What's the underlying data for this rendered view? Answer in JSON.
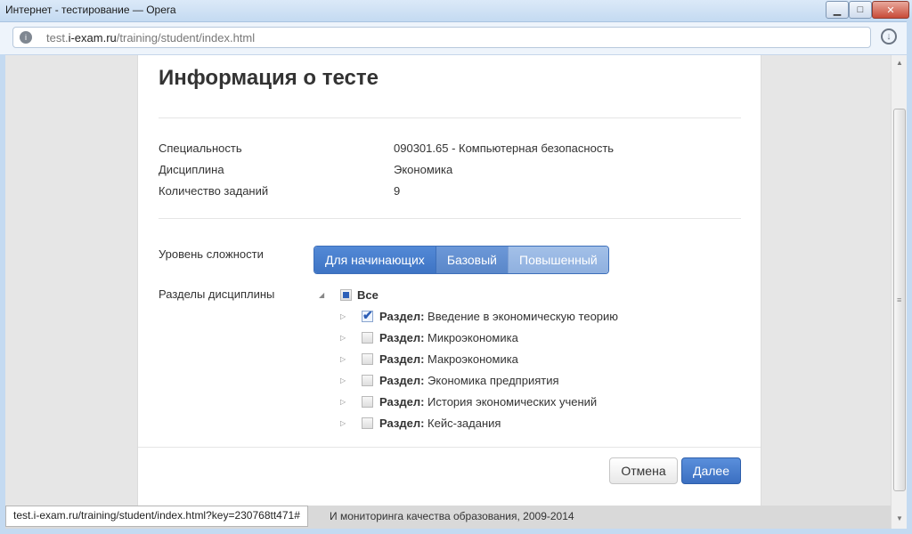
{
  "window": {
    "title": "Интернет - тестирование — Opera",
    "min_glyph": "▁",
    "max_glyph": "□",
    "close_glyph": "✕"
  },
  "address": {
    "prefix": "test.",
    "host": "i-exam.ru",
    "path": "/training/student/index.html",
    "site_icon": "info-icon",
    "download_icon": "download-icon"
  },
  "modal": {
    "title": "Информация о тесте",
    "info": [
      {
        "label": "Специальность",
        "value": "090301.65 - Компьютерная безопасность"
      },
      {
        "label": "Дисциплина",
        "value": "Экономика"
      },
      {
        "label": "Количество заданий",
        "value": "9"
      }
    ],
    "difficulty_label": "Уровень сложности",
    "difficulty_options": [
      "Для начинающих",
      "Базовый",
      "Повышенный"
    ],
    "difficulty_selected": "Для начинающих",
    "sections_label": "Разделы дисциплины",
    "tree_root": {
      "label": "Все",
      "state": "partial"
    },
    "section_prefix": "Раздел:",
    "sections": [
      {
        "name": "Введение в экономическую теорию",
        "checked": true
      },
      {
        "name": "Микроэкономика",
        "checked": false
      },
      {
        "name": "Макроэкономика",
        "checked": false
      },
      {
        "name": "Экономика предприятия",
        "checked": false
      },
      {
        "name": "История экономических учений",
        "checked": false
      },
      {
        "name": "Кейс-задания",
        "checked": false
      }
    ],
    "cancel_label": "Отмена",
    "next_label": "Далее"
  },
  "footer": {
    "copyright": "И мониторинга качества образования, 2009-2014",
    "status_url": "test.i-exam.ru/training/student/index.html?key=230768tt471#"
  },
  "colors": {
    "accent": "#3e74c4",
    "page_bg": "#e6e6e6"
  }
}
